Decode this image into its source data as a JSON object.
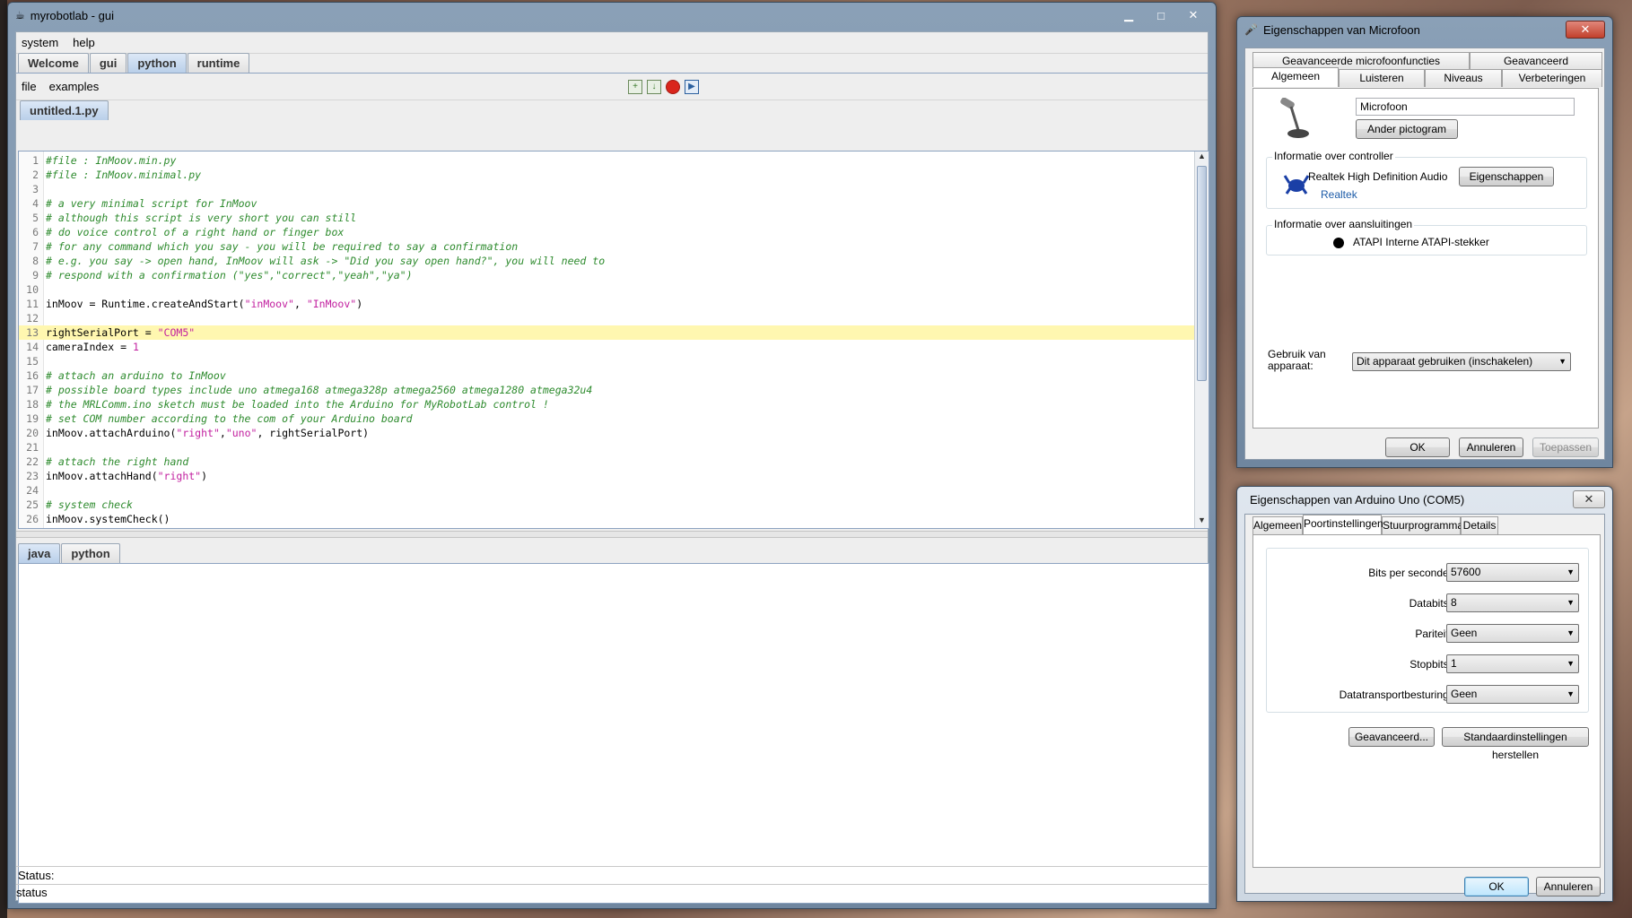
{
  "mrl": {
    "title": "myrobotlab - gui",
    "menu": [
      "system",
      "help"
    ],
    "tabs": [
      "Welcome",
      "gui",
      "python",
      "runtime"
    ],
    "active_tab": "python",
    "python_menu": [
      "file",
      "examples"
    ],
    "file_tab": "untitled.1.py",
    "console_tabs": [
      "java",
      "python"
    ],
    "status_label": "Status:",
    "status_text": "status"
  },
  "code_lines": [
    {
      "n": "1",
      "parts": [
        {
          "t": "#file : InMoov.min.py",
          "c": "cm"
        }
      ]
    },
    {
      "n": "2",
      "parts": [
        {
          "t": "#file : InMoov.minimal.py",
          "c": "cm"
        }
      ]
    },
    {
      "n": "3",
      "parts": []
    },
    {
      "n": "4",
      "parts": [
        {
          "t": "# a very minimal script for InMoov",
          "c": "cm"
        }
      ]
    },
    {
      "n": "5",
      "parts": [
        {
          "t": "# although this script is very short you can still",
          "c": "cm"
        }
      ]
    },
    {
      "n": "6",
      "parts": [
        {
          "t": "# do voice control of a right hand or finger box",
          "c": "cm"
        }
      ]
    },
    {
      "n": "7",
      "parts": [
        {
          "t": "# for any command which you say - you will be required to say a confirmation",
          "c": "cm"
        }
      ]
    },
    {
      "n": "8",
      "parts": [
        {
          "t": "# e.g. you say -> open hand, InMoov will ask -> \"Did you say open hand?\", you will need to",
          "c": "cm"
        }
      ]
    },
    {
      "n": "9",
      "parts": [
        {
          "t": "# respond with a confirmation (\"yes\",\"correct\",\"yeah\",\"ya\")",
          "c": "cm"
        }
      ]
    },
    {
      "n": "10",
      "parts": []
    },
    {
      "n": "11",
      "parts": [
        {
          "t": "inMoov = Runtime.createAndStart(",
          "c": ""
        },
        {
          "t": "\"inMoov\"",
          "c": "str"
        },
        {
          "t": ", ",
          "c": ""
        },
        {
          "t": "\"InMoov\"",
          "c": "str"
        },
        {
          "t": ")",
          "c": ""
        }
      ]
    },
    {
      "n": "12",
      "parts": []
    },
    {
      "n": "13",
      "hl": true,
      "parts": [
        {
          "t": "rightSerialPort = ",
          "c": ""
        },
        {
          "t": "\"COM5\"",
          "c": "str"
        }
      ]
    },
    {
      "n": "14",
      "parts": [
        {
          "t": "cameraIndex = ",
          "c": ""
        },
        {
          "t": "1",
          "c": "num"
        }
      ]
    },
    {
      "n": "15",
      "parts": []
    },
    {
      "n": "16",
      "parts": [
        {
          "t": "# attach an arduino to InMoov",
          "c": "cm"
        }
      ]
    },
    {
      "n": "17",
      "parts": [
        {
          "t": "# possible board types include uno atmega168 atmega328p atmega2560 atmega1280 atmega32u4",
          "c": "cm"
        }
      ]
    },
    {
      "n": "18",
      "parts": [
        {
          "t": "# the MRLComm.ino sketch must be loaded into the Arduino for MyRobotLab control !",
          "c": "cm"
        }
      ]
    },
    {
      "n": "19",
      "parts": [
        {
          "t": "# set COM number according to the com of your Arduino board",
          "c": "cm"
        }
      ]
    },
    {
      "n": "20",
      "parts": [
        {
          "t": "inMoov.attachArduino(",
          "c": ""
        },
        {
          "t": "\"right\"",
          "c": "str"
        },
        {
          "t": ",",
          "c": ""
        },
        {
          "t": "\"uno\"",
          "c": "str"
        },
        {
          "t": ", rightSerialPort)",
          "c": ""
        }
      ]
    },
    {
      "n": "21",
      "parts": []
    },
    {
      "n": "22",
      "parts": [
        {
          "t": "# attach the right hand",
          "c": "cm"
        }
      ]
    },
    {
      "n": "23",
      "parts": [
        {
          "t": "inMoov.attachHand(",
          "c": ""
        },
        {
          "t": "\"right\"",
          "c": "str"
        },
        {
          "t": ")",
          "c": ""
        }
      ]
    },
    {
      "n": "24",
      "parts": []
    },
    {
      "n": "25",
      "parts": [
        {
          "t": "# system check",
          "c": "cm"
        }
      ]
    },
    {
      "n": "26",
      "parts": [
        {
          "t": "inMoov.systemCheck()",
          "c": ""
        }
      ]
    }
  ],
  "mic_dialog": {
    "title": "Eigenschappen van Microfoon",
    "tabs_top": [
      "Geavanceerde microfoonfuncties",
      "Geavanceerd"
    ],
    "tabs_bottom": [
      "Algemeen",
      "Luisteren",
      "Niveaus",
      "Verbeteringen"
    ],
    "device_name": "Microfoon",
    "change_icon_btn": "Ander pictogram",
    "controller_group": "Informatie over controller",
    "controller_name": "Realtek High Definition Audio",
    "controller_vendor": "Realtek",
    "properties_btn": "Eigenschappen",
    "jacks_group": "Informatie over aansluitingen",
    "jack_name": "ATAPI Interne ATAPI-stekker",
    "usage_label": "Gebruik van apparaat:",
    "usage_value": "Dit apparaat gebruiken (inschakelen)",
    "ok": "OK",
    "cancel": "Annuleren",
    "apply": "Toepassen"
  },
  "com_dialog": {
    "title": "Eigenschappen van Arduino Uno (COM5)",
    "tabs": [
      "Algemeen",
      "Poortinstellingen",
      "Stuurprogramma",
      "Details"
    ],
    "active_tab": "Poortinstellingen",
    "fields": [
      {
        "label": "Bits per seconde:",
        "value": "57600"
      },
      {
        "label": "Databits:",
        "value": "8"
      },
      {
        "label": "Pariteit:",
        "value": "Geen"
      },
      {
        "label": "Stopbits:",
        "value": "1"
      },
      {
        "label": "Datatransportbesturing:",
        "value": "Geen"
      }
    ],
    "advanced_btn": "Geavanceerd...",
    "restore_btn": "Standaardinstellingen herstellen",
    "ok": "OK",
    "cancel": "Annuleren"
  },
  "colors": {
    "comment": "#2e8b2e",
    "string": "#c21f9f",
    "highlight": "#fff7b0"
  }
}
